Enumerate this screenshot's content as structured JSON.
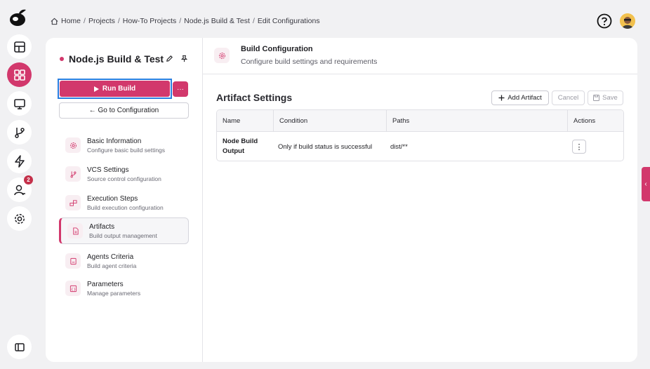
{
  "breadcrumb": {
    "items": [
      "Home",
      "Projects",
      "How-To Projects",
      "Node.js Build & Test",
      "Edit Configurations"
    ],
    "separator": "/"
  },
  "project": {
    "title": "Node.js Build & Test",
    "run_label": "Run Build",
    "more_label": "···",
    "goto_label": "← Go to Configuration"
  },
  "rail": {
    "badge_count": "2"
  },
  "nav": [
    {
      "label": "Basic Information",
      "sub": "Configure basic build settings"
    },
    {
      "label": "VCS Settings",
      "sub": "Source control configuration"
    },
    {
      "label": "Execution Steps",
      "sub": "Build execution configuration"
    },
    {
      "label": "Artifacts",
      "sub": "Build output management"
    },
    {
      "label": "Agents Criteria",
      "sub": "Build agent criteria"
    },
    {
      "label": "Parameters",
      "sub": "Manage parameters"
    }
  ],
  "config": {
    "title": "Build Configuration",
    "subtitle": "Configure build settings and requirements"
  },
  "artifacts": {
    "title": "Artifact Settings",
    "add_label": "Add Artifact",
    "cancel_label": "Cancel",
    "save_label": "Save",
    "columns": [
      "Name",
      "Condition",
      "Paths",
      "Actions"
    ],
    "rows": [
      {
        "name": "Node Build Output",
        "condition": "Only if build status is successful",
        "paths": "dist/**",
        "actions": "⋮"
      }
    ]
  },
  "side_tab": {
    "label": "‹"
  },
  "colors": {
    "accent": "#d2386c",
    "focus": "#2a7ee0"
  }
}
